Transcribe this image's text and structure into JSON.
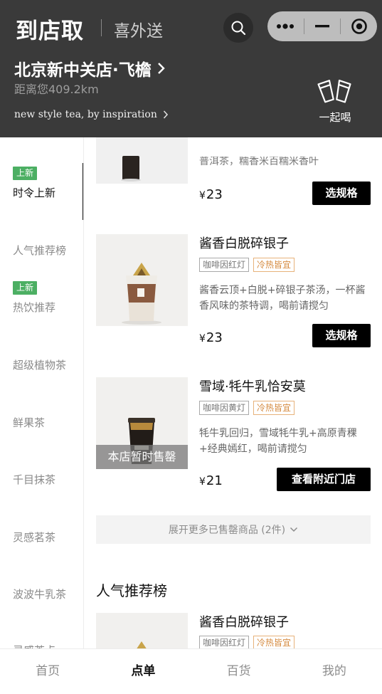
{
  "header": {
    "mode_active": "到店取",
    "mode_other": "喜外送",
    "store_name": "北京新中关店·飞檐",
    "distance": "距离您409.2km",
    "slogan": "new style tea, by inspiration",
    "together_label": "一起喝"
  },
  "sidebar": {
    "new_badge": "上新",
    "categories": [
      "时令上新",
      "人气推荐榜",
      "热饮推荐",
      "超级植物茶",
      "鲜果茶",
      "千目抹茶",
      "灵感茗茶",
      "波波牛乳茶",
      "灵感茶点"
    ]
  },
  "products": [
    {
      "desc_partial": "普洱茶，糯香米百糯米香叶",
      "currency": "¥",
      "price": "23",
      "button": "选规格"
    },
    {
      "name": "酱香白脱碎银子",
      "tags": [
        "咖啡因红灯",
        "冷热皆宜"
      ],
      "desc": "酱香云顶+白脱+碎银子茶汤，一杯酱香风味的茶特调，喝前请搅匀",
      "currency": "¥",
      "price": "23",
      "button": "选规格"
    },
    {
      "name": "雪域·牦牛乳恰安莫",
      "tags": [
        "咖啡因黄灯",
        "冷热皆宜"
      ],
      "desc": "牦牛乳回归，雪域牦牛乳+高原青稞+经典嫣红，喝前请搅匀",
      "currency": "¥",
      "price": "21",
      "button": "查看附近门店",
      "soldout": "本店暂时售罄"
    }
  ],
  "expand_more": "展开更多已售罄商品 (2件)",
  "section_title": "人气推荐榜",
  "section_product": {
    "name": "酱香白脱碎银子",
    "tags": [
      "咖啡因红灯",
      "冷热皆宜"
    ]
  },
  "bottom_nav": [
    "首页",
    "点单",
    "百货",
    "我的"
  ],
  "colors": {
    "header_bg": "#3a3a3a",
    "badge_green": "#4caf63",
    "warm_tag": "#d58a3f",
    "button_black": "#000000"
  }
}
